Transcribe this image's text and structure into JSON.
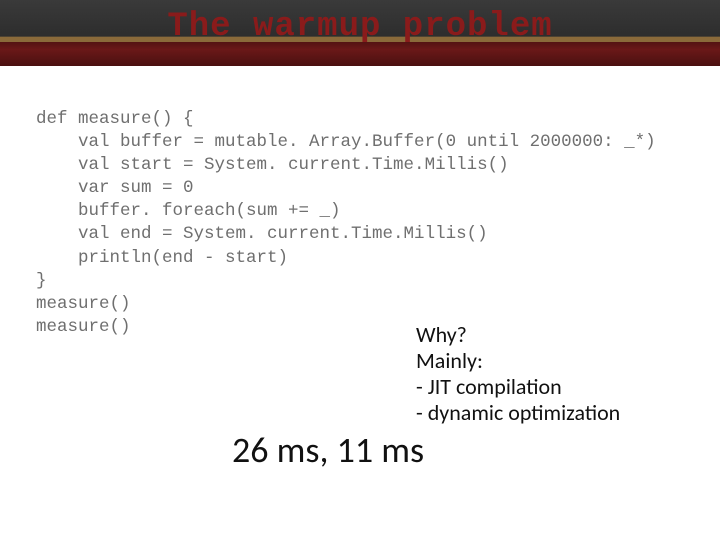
{
  "header": {
    "title": "The warmup problem"
  },
  "code": {
    "l1": "def measure() {",
    "l2": "    val buffer = mutable. Array.Buffer(0 until 2000000: _*)",
    "l3": "    val start = System. current.Time.Millis()",
    "l4": "    var sum = 0",
    "l5": "    buffer. foreach(sum += _)",
    "l6": "    val end = System. current.Time.Millis()",
    "l7": "    println(end - start)",
    "l8": "}",
    "l9": "measure()",
    "l10": "measure()"
  },
  "why": {
    "q": "Why?",
    "mainly": "Mainly:",
    "b1": "- JIT compilation",
    "b2": "- dynamic optimization"
  },
  "result": "26 ms, 11 ms"
}
